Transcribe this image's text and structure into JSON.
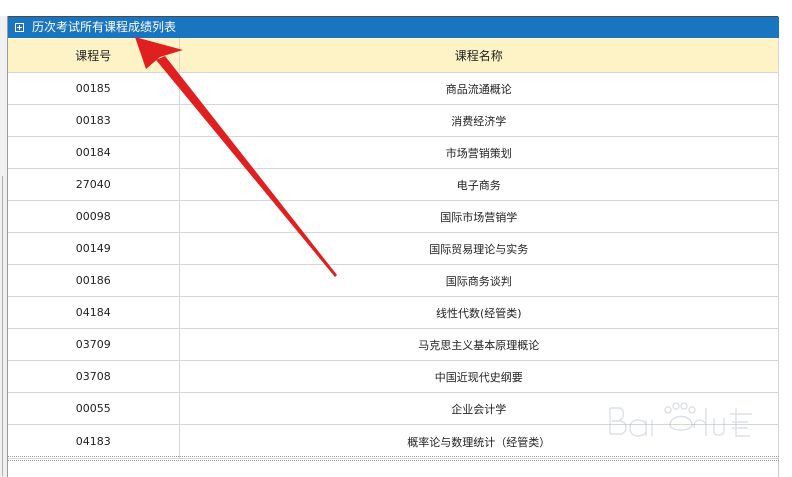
{
  "panel": {
    "title": "历次考试所有课程成绩列表"
  },
  "table": {
    "headers": {
      "code": "课程号",
      "name": "课程名称"
    },
    "rows": [
      {
        "code": "00185",
        "name": "商品流通概论"
      },
      {
        "code": "00183",
        "name": "消费经济学"
      },
      {
        "code": "00184",
        "name": "市场营销策划"
      },
      {
        "code": "27040",
        "name": "电子商务"
      },
      {
        "code": "00098",
        "name": "国际市场营销学"
      },
      {
        "code": "00149",
        "name": "国际贸易理论与实务"
      },
      {
        "code": "00186",
        "name": "国际商务谈判"
      },
      {
        "code": "04184",
        "name": "线性代数(经管类)"
      },
      {
        "code": "03709",
        "name": "马克思主义基本原理概论"
      },
      {
        "code": "03708",
        "name": "中国近现代史纲要"
      },
      {
        "code": "00055",
        "name": "企业会计学"
      },
      {
        "code": "04183",
        "name": "概率论与数理统计（经管类）"
      }
    ]
  },
  "watermark": {
    "text": "Baidu经验"
  },
  "colors": {
    "title_bar": "#1a75c0",
    "header_bg": "#fdf3c6",
    "grid_line": "#d6d6d6",
    "arrow": "#e02020"
  }
}
